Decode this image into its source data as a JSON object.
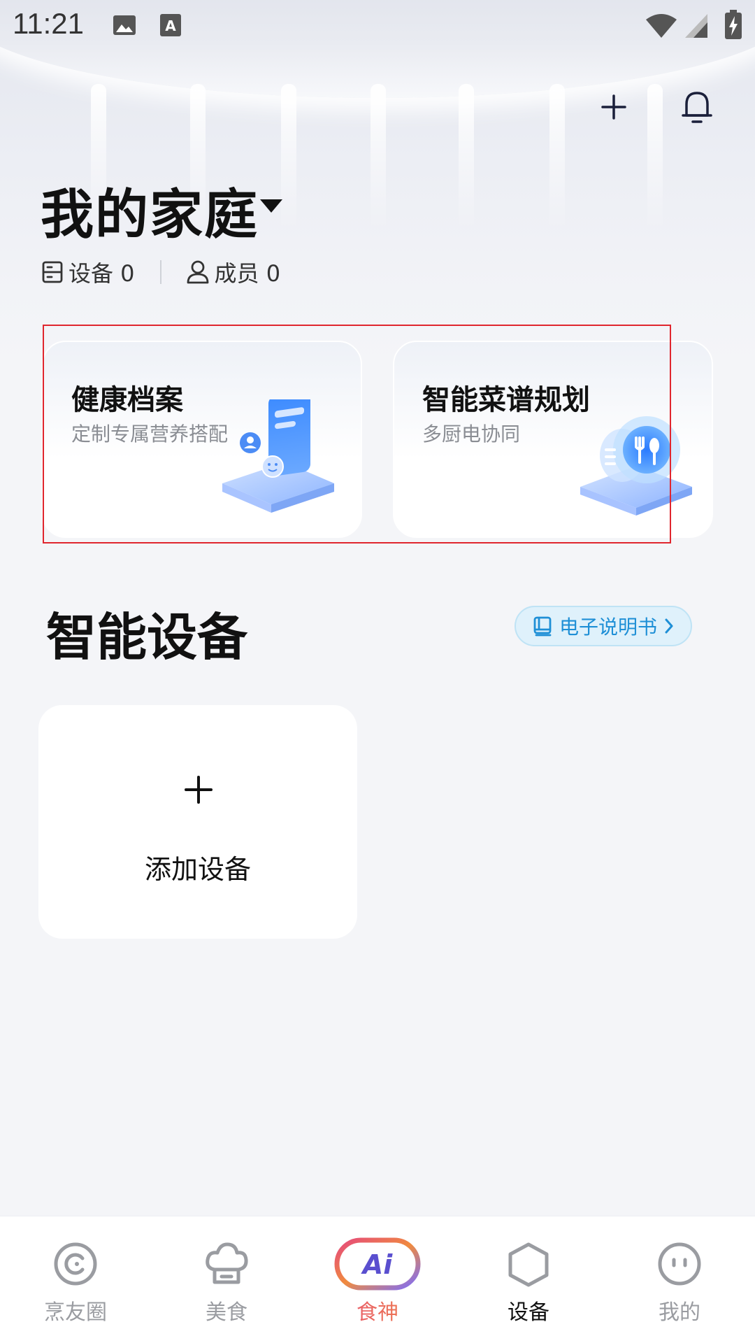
{
  "status_bar": {
    "time": "11:21"
  },
  "header": {
    "family_name": "我的家庭",
    "devices_label": "设备 0",
    "members_label": "成员 0"
  },
  "feature_cards": [
    {
      "title": "健康档案",
      "subtitle": "定制专属营养搭配"
    },
    {
      "title": "智能菜谱规划",
      "subtitle": "多厨电协同"
    }
  ],
  "section": {
    "title": "智能设备",
    "manual_button": "电子说明书"
  },
  "add_device": {
    "label": "添加设备"
  },
  "bottom_nav": {
    "items": [
      {
        "label": "烹友圈",
        "icon": "circle-c-icon"
      },
      {
        "label": "美食",
        "icon": "chef-hat-icon"
      },
      {
        "label": "食神",
        "icon": "ai-badge-icon",
        "ai_text": "Ai"
      },
      {
        "label": "设备",
        "icon": "hexagon-icon",
        "active": true
      },
      {
        "label": "我的",
        "icon": "face-icon"
      }
    ]
  },
  "colors": {
    "accent_blue": "#1e8fd6",
    "ai_gradient_start": "#e5487d",
    "ai_gradient_end": "#f08b3e",
    "highlight_border": "#e0262e"
  }
}
